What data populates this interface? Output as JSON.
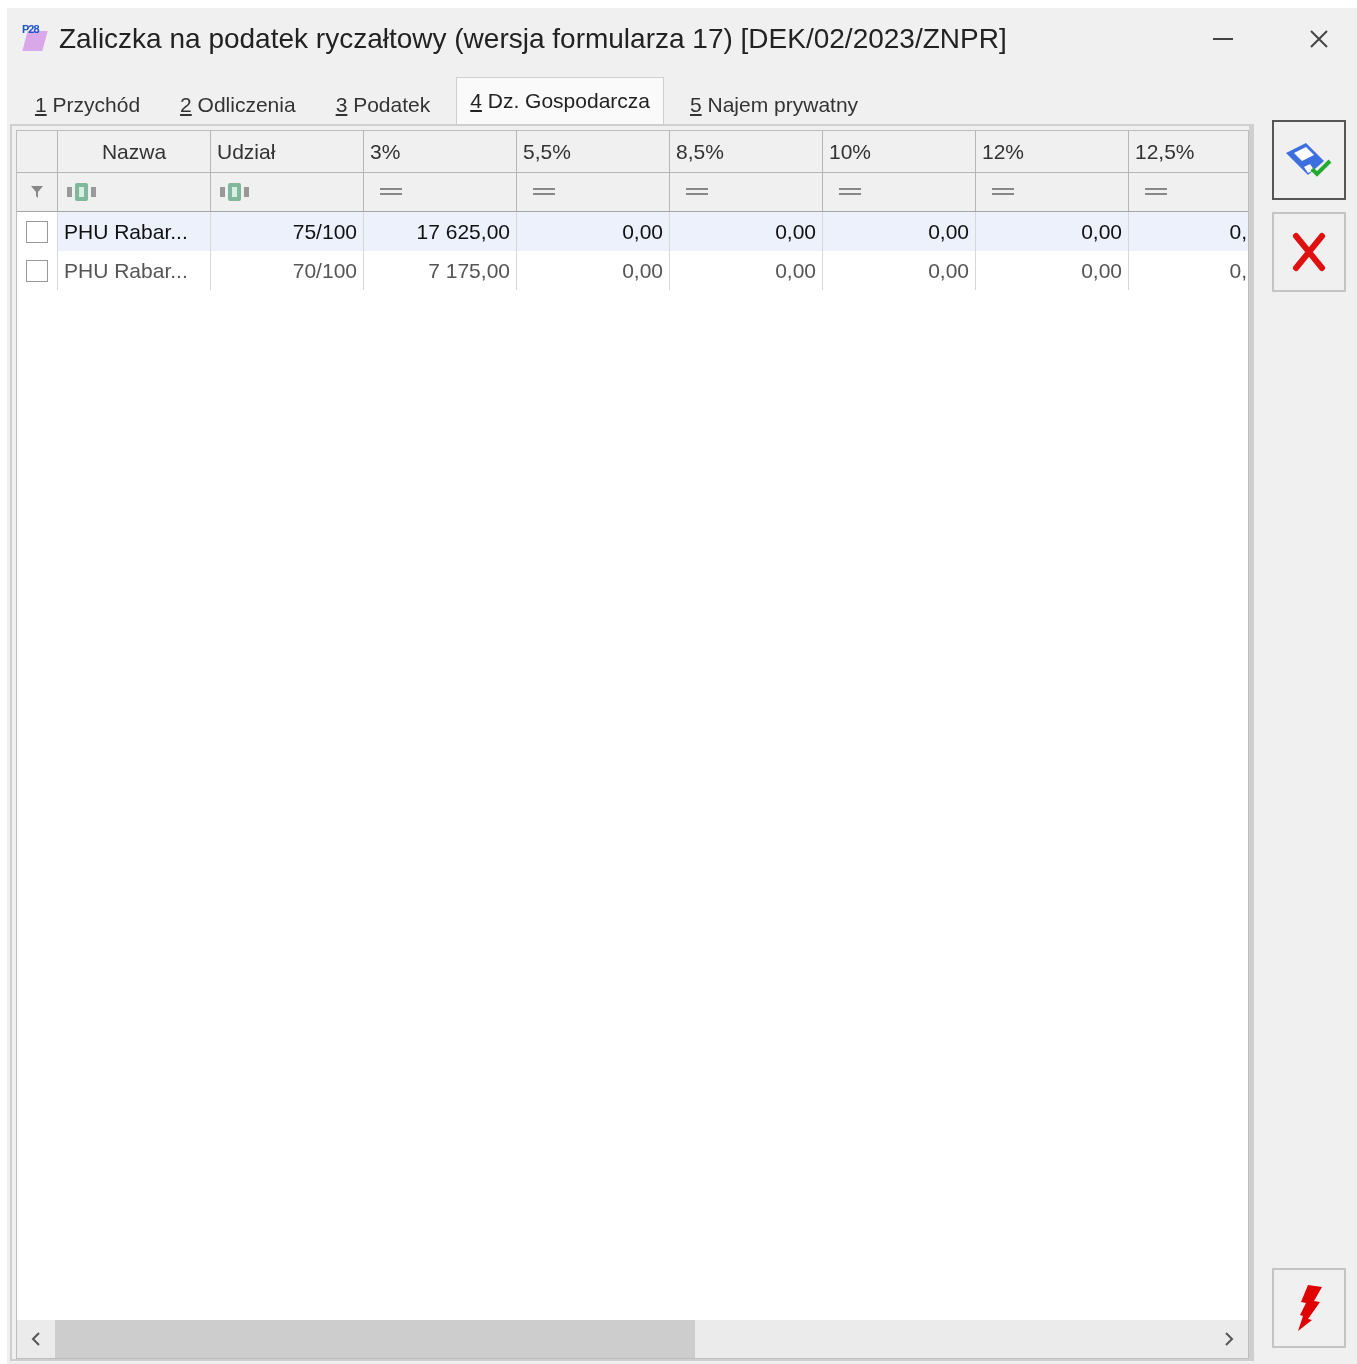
{
  "window": {
    "icon_text": "P28",
    "title": "Zaliczka na podatek ryczałtowy (wersja formularza 17) [DEK/02/2023/ZNPR]"
  },
  "tabs": [
    {
      "key": "1",
      "label": "Przychód",
      "selected": false
    },
    {
      "key": "2",
      "label": "Odliczenia",
      "selected": false
    },
    {
      "key": "3",
      "label": "Podatek",
      "selected": false
    },
    {
      "key": "4",
      "label": "Dz. Gospodarcza",
      "selected": true
    },
    {
      "key": "5",
      "label": "Najem prywatny",
      "selected": false
    }
  ],
  "table": {
    "columns": [
      {
        "label": "Nazwa",
        "filter": {
          "kind": "text"
        }
      },
      {
        "label": "Udział",
        "filter": {
          "kind": "text"
        }
      },
      {
        "label": "3%",
        "filter": {
          "kind": "equals"
        }
      },
      {
        "label": "5,5%",
        "filter": {
          "kind": "equals"
        }
      },
      {
        "label": "8,5%",
        "filter": {
          "kind": "equals"
        }
      },
      {
        "label": "10%",
        "filter": {
          "kind": "equals"
        }
      },
      {
        "label": "12%",
        "filter": {
          "kind": "equals"
        }
      },
      {
        "label": "12,5%",
        "filter": {
          "kind": "equals"
        }
      }
    ],
    "rows": [
      {
        "checked": false,
        "selected": true,
        "cells": [
          "PHU Rabar...",
          "75/100",
          "17 625,00",
          "0,00",
          "0,00",
          "0,00",
          "0,00",
          "0,"
        ]
      },
      {
        "checked": false,
        "selected": false,
        "cells": [
          "PHU Rabar...",
          "70/100",
          "7 175,00",
          "0,00",
          "0,00",
          "0,00",
          "0,00",
          "0,"
        ]
      }
    ]
  },
  "toolbar": [
    {
      "kind": "save"
    },
    {
      "kind": "cancel"
    },
    {
      "kind": "flash"
    }
  ]
}
